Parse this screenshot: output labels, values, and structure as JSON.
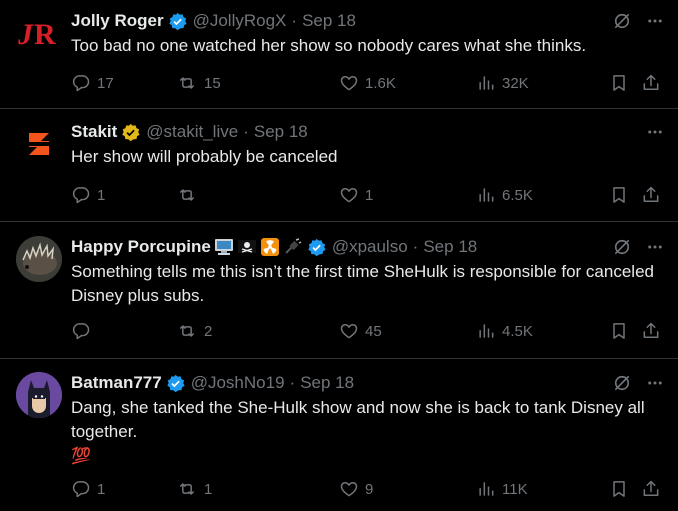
{
  "tweets": [
    {
      "name": "Jolly Roger",
      "handle": "@JollyRogX",
      "date": "Sep 18",
      "text": "Too bad no one watched her show so nobody cares what she thinks.",
      "replies": "17",
      "reposts": "15",
      "likes": "1.6K",
      "views": "32K",
      "verified": "blue",
      "avatar_letters": "JR"
    },
    {
      "name": "Stakit",
      "handle": "@stakit_live",
      "date": "Sep 18",
      "text": "Her show will probably be canceled",
      "replies": "1",
      "reposts": "",
      "likes": "1",
      "views": "6.5K",
      "verified": "gold"
    },
    {
      "name": "Happy Porcupine",
      "handle": "@xpaulso",
      "date": "Sep 18",
      "text": "Something tells me this isn’t the first time SheHulk is responsible for canceled Disney plus subs.",
      "replies": "",
      "reposts": "2",
      "likes": "45",
      "views": "4.5K",
      "verified": "blue"
    },
    {
      "name": "Batman777",
      "handle": "@JoshNo19",
      "date": "Sep 18",
      "text": "Dang, she tanked the She-Hulk show and now she is back to tank Disney all together.",
      "emoji_line": "💯",
      "replies": "1",
      "reposts": "1",
      "likes": "9",
      "views": "11K",
      "verified": "blue"
    }
  ],
  "colors": {
    "background": "#000000",
    "text": "#e7e9ea",
    "muted": "#71767b",
    "divider": "#2f3336",
    "verified_blue": "#1d9bf0",
    "verified_gold": "#e2b719",
    "jr_red": "#d81f26",
    "stakit_orange": "#f2541b"
  },
  "icons": {
    "reply": "reply-icon",
    "repost": "repost-icon",
    "like": "heart-icon",
    "views": "views-icon",
    "bookmark": "bookmark-icon",
    "share": "share-icon",
    "more": "more-icon",
    "grok": "grok-icon"
  }
}
